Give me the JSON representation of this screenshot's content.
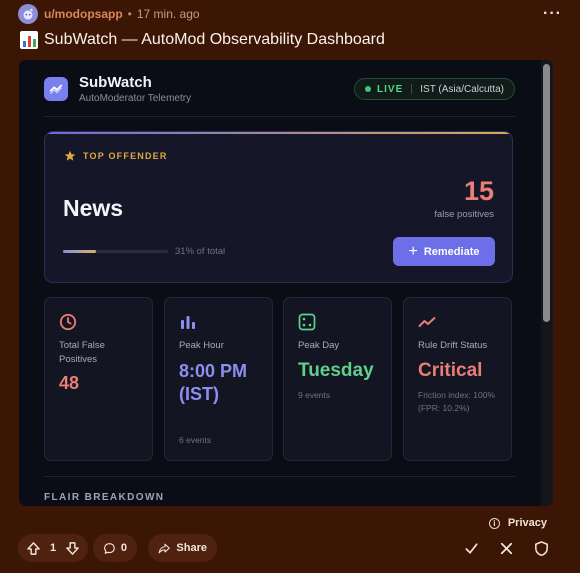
{
  "post": {
    "username": "u/modopsapp",
    "separator": "•",
    "time": "17 min. ago",
    "title": "SubWatch — AutoMod Observability Dashboard"
  },
  "app": {
    "name": "SubWatch",
    "subtitle": "AutoModerator Telemetry",
    "live_label": "LIVE",
    "timezone": "IST (Asia/Calcutta)"
  },
  "top_offender": {
    "label": "TOP OFFENDER",
    "name": "News",
    "count": "15",
    "count_label": "false positives",
    "share_label": "31% of total",
    "share_fraction": 0.31,
    "action_label": "Remediate"
  },
  "cards": [
    {
      "label": "Total False Positives",
      "value": "48",
      "note": "",
      "icon": "clock-icon",
      "color": "#ea7d76"
    },
    {
      "label": "Peak Hour",
      "value": "8:00 PM (IST)",
      "note": "6 events",
      "icon": "bar-chart-icon",
      "color": "#8c8ef0"
    },
    {
      "label": "Peak Day",
      "value": "Tuesday",
      "note": "9 events",
      "icon": "dice-icon",
      "color": "#5fd08a"
    },
    {
      "label": "Rule Drift Status",
      "value": "Critical",
      "note": "Friction index: 100% (FPR: 10.2%)",
      "icon": "trend-icon",
      "color": "#ea7d76"
    }
  ],
  "section": {
    "flair_heading": "FLAIR BREAKDOWN"
  },
  "footer": {
    "privacy_label": "Privacy",
    "vote_count": "1",
    "comment_count": "0",
    "share_label": "Share"
  },
  "colors": {
    "background": "#3c1605",
    "panel": "#0b0d16",
    "accent": "#6c6fe8",
    "danger": "#ea7d76",
    "success": "#5fd08a",
    "warning": "#e0a83e"
  }
}
